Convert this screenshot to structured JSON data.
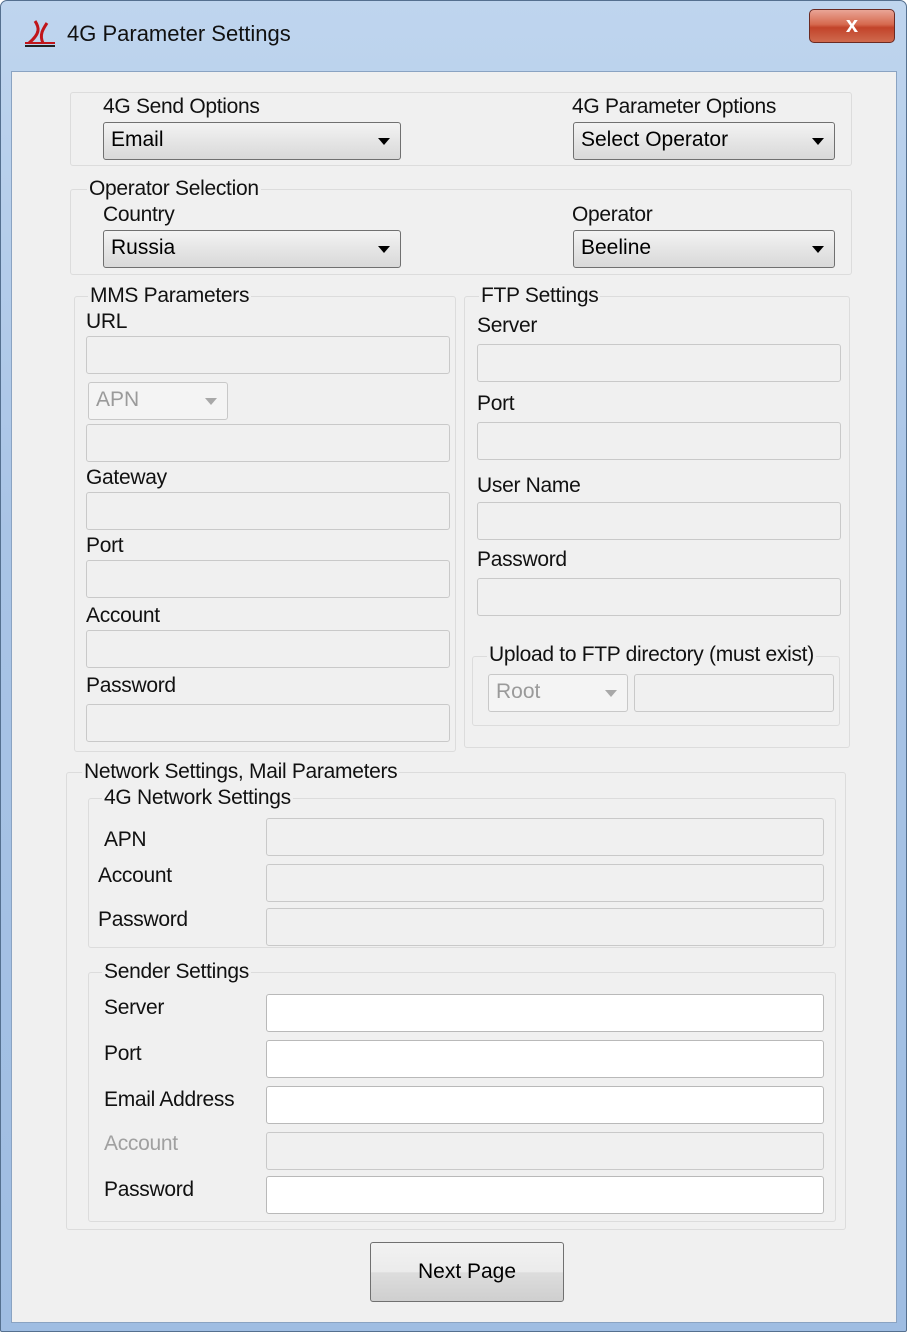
{
  "window": {
    "title": "4G Parameter Settings",
    "close_label": "x"
  },
  "send_options": {
    "label": "4G Send Options",
    "value": "Email"
  },
  "parameter_options": {
    "label": "4G Parameter Options",
    "value": "Select Operator"
  },
  "operator_selection": {
    "legend": "Operator Selection",
    "country_label": "Country",
    "country_value": "Russia",
    "operator_label": "Operator",
    "operator_value": "Beeline"
  },
  "mms": {
    "legend": "MMS Parameters",
    "url_label": "URL",
    "apn_combo": "APN",
    "gateway_label": "Gateway",
    "port_label": "Port",
    "account_label": "Account",
    "password_label": "Password"
  },
  "ftp": {
    "legend": "FTP Settings",
    "server_label": "Server",
    "port_label": "Port",
    "username_label": "User Name",
    "password_label": "Password",
    "upload_legend": "Upload to FTP directory (must exist)",
    "root_combo": "Root"
  },
  "network_mail": {
    "legend": "Network Settings, Mail Parameters",
    "network": {
      "legend": "4G Network Settings",
      "apn_label": "APN",
      "account_label": "Account",
      "password_label": "Password"
    },
    "sender": {
      "legend": "Sender Settings",
      "server_label": "Server",
      "port_label": "Port",
      "email_label": "Email Address",
      "account_label": "Account",
      "password_label": "Password"
    }
  },
  "next_button": "Next Page",
  "colors": {
    "title_bar": "#a9c4e6",
    "close_button": "#c2432a",
    "client_bg": "#f0f0f0"
  }
}
